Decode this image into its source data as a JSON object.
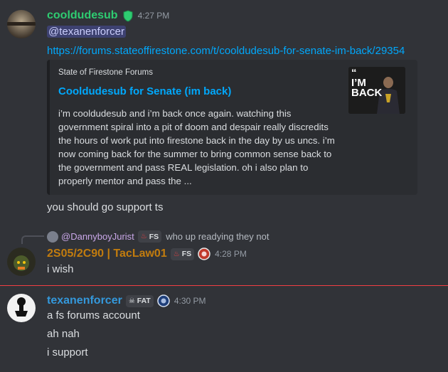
{
  "messages": [
    {
      "author": "cooldudesub",
      "author_color": "#2ecc71",
      "timestamp": "4:27 PM",
      "lines": [
        "@texanenforcer",
        "https://forums.stateoffirestone.com/t/cooldudesub-for-senate-im-back/29354",
        "you should go support ts"
      ],
      "embed": {
        "provider": "State of Firestone Forums",
        "title": "Cooldudesub for Senate (im back)",
        "description_lines": [
          "i’m cooldudesub and i’m back once again. watching this",
          "government spiral into a pit of doom and despair really discredits",
          "the hours of work put into firestone back in the day by us uncs. i’m",
          "now coming back for the summer to bring common sense back to",
          "the government and pass REAL legislation. oh i also plan to",
          "properly mentor and pass the ..."
        ],
        "thumbnail_text": "“\nI’M\nBACK"
      }
    },
    {
      "reply": {
        "to_author": "@DannyboyJurist",
        "to_tag": "FS",
        "preview": "who up readying they not"
      },
      "author": "2S05/2C90 | TacLaw01",
      "author_color": "#c27c0e",
      "tag": "FS",
      "timestamp": "4:28 PM",
      "lines": [
        "i wish"
      ]
    },
    {
      "author": "texanenforcer",
      "author_color": "#3498db",
      "tag": "FAT",
      "timestamp": "4:30 PM",
      "lines": [
        "a fs forums account",
        "ah nah",
        "i support"
      ]
    }
  ]
}
